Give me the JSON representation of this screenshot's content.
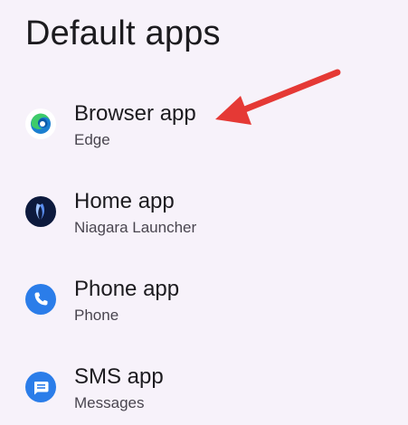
{
  "page": {
    "title": "Default apps"
  },
  "items": [
    {
      "title": "Browser app",
      "summary": "Edge",
      "icon": "edge-icon"
    },
    {
      "title": "Home app",
      "summary": "Niagara Launcher",
      "icon": "niagara-launcher-icon"
    },
    {
      "title": "Phone app",
      "summary": "Phone",
      "icon": "phone-icon"
    },
    {
      "title": "SMS app",
      "summary": "Messages",
      "icon": "messages-icon"
    }
  ],
  "colors": {
    "background": "#f7f2fa",
    "arrow": "#e53935",
    "phone_blue": "#2b7de9",
    "niagara_navy": "#0d1a3d"
  }
}
